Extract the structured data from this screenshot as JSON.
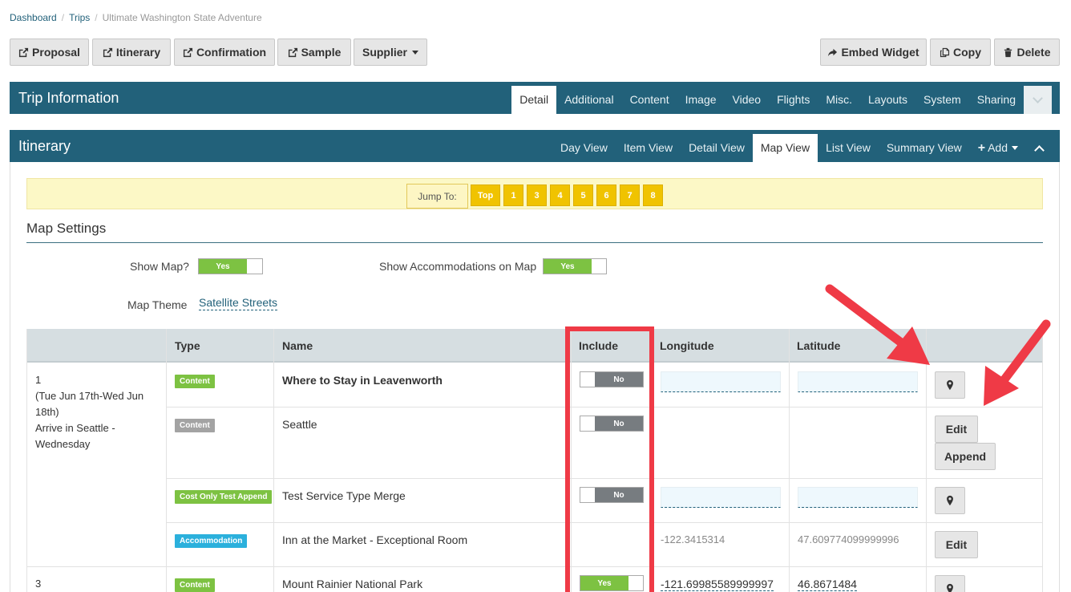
{
  "breadcrumb": {
    "dashboard": "Dashboard",
    "trips": "Trips",
    "current": "Ultimate Washington State Adventure"
  },
  "toolbar": {
    "proposal": "Proposal",
    "itinerary": "Itinerary",
    "confirmation": "Confirmation",
    "sample": "Sample",
    "supplier": "Supplier",
    "embed": "Embed Widget",
    "copy": "Copy",
    "delete": "Delete"
  },
  "trip_panel": {
    "title": "Trip Information",
    "tabs": [
      "Detail",
      "Additional",
      "Content",
      "Image",
      "Video",
      "Flights",
      "Misc.",
      "Layouts",
      "System",
      "Sharing"
    ],
    "active_tab": "Detail"
  },
  "itinerary_panel": {
    "title": "Itinerary",
    "tabs": [
      "Day View",
      "Item View",
      "Detail View",
      "Map View",
      "List View",
      "Summary View"
    ],
    "add_label": "Add",
    "active_tab": "Map View"
  },
  "jump": {
    "label": "Jump To:",
    "buttons": [
      "Top",
      "1",
      "3",
      "4",
      "5",
      "6",
      "7",
      "8"
    ]
  },
  "map_settings": {
    "title": "Map Settings",
    "show_map_label": "Show Map?",
    "show_map_value": "Yes",
    "show_acc_label": "Show Accommodations on Map",
    "show_acc_value": "Yes",
    "theme_label": "Map Theme",
    "theme_value": "Satellite Streets"
  },
  "table": {
    "headers": {
      "type": "Type",
      "name": "Name",
      "include": "Include",
      "longitude": "Longitude",
      "latitude": "Latitude"
    },
    "day1": {
      "number": "1",
      "dates": "(Tue Jun 17th-Wed Jun 18th)",
      "title": "Arrive in Seattle - Wednesday"
    },
    "day3": {
      "number": "3"
    },
    "rows": [
      {
        "type": "Content",
        "name": "Where to Stay in Leavenworth",
        "include": "No",
        "longitude": "",
        "latitude": ""
      },
      {
        "type": "Content",
        "name": "Seattle",
        "include": "No",
        "edit": "Edit",
        "append": "Append"
      },
      {
        "type": "Cost Only Test Append",
        "name": "Test Service Type Merge",
        "include": "No",
        "longitude": "",
        "latitude": ""
      },
      {
        "type": "Accommodation",
        "name": "Inn at the Market - Exceptional Room",
        "longitude": "-122.3415314",
        "latitude": "47.609774099999996",
        "edit": "Edit"
      },
      {
        "type": "Content",
        "name": "Mount Rainier National Park",
        "include": "Yes",
        "longitude": "-121.69985589999997",
        "latitude": "46.8671484"
      }
    ]
  },
  "colors": {
    "header": "#22617a",
    "highlight": "#ef3a46",
    "badge_green": "#7dc242",
    "badge_blue": "#2bb0dc",
    "jump": "#f0c300"
  }
}
